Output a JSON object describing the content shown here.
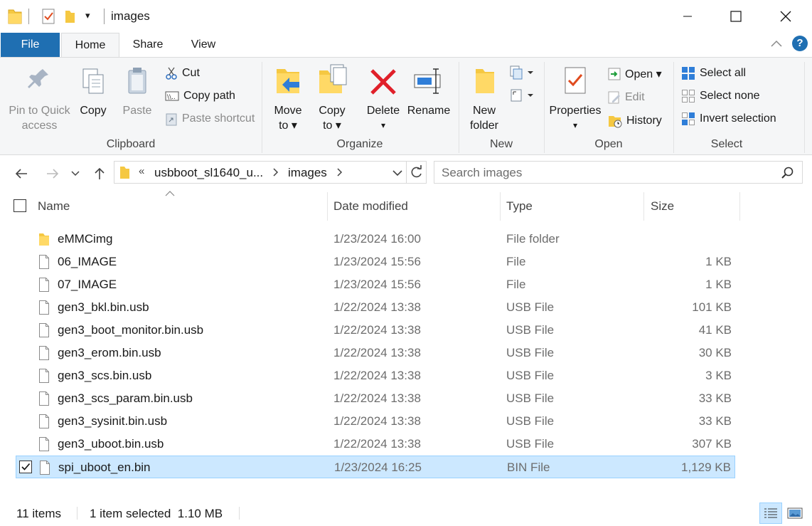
{
  "window": {
    "title": "images",
    "qa_dropdown": "▾",
    "minimize": "—",
    "maximize": "☐",
    "close": "✕"
  },
  "ribbon_tabs": {
    "file": "File",
    "home": "Home",
    "share": "Share",
    "view": "View"
  },
  "clipboard": {
    "pin": "Pin to Quick\naccess",
    "pin_l1": "Pin to Quick",
    "pin_l2": "access",
    "copy": "Copy",
    "paste": "Paste",
    "cut": "Cut",
    "copy_path": "Copy path",
    "paste_shortcut": "Paste shortcut",
    "label": "Clipboard"
  },
  "organize": {
    "move_l1": "Move",
    "move_l2": "to ▾",
    "copy_l1": "Copy",
    "copy_l2": "to ▾",
    "delete": "Delete",
    "delete_arrow": "▾",
    "rename": "Rename",
    "label": "Organize"
  },
  "new": {
    "folder_l1": "New",
    "folder_l2": "folder",
    "label": "New"
  },
  "open": {
    "properties": "Properties",
    "properties_arrow": "▾",
    "open": "Open ▾",
    "edit": "Edit",
    "history": "History",
    "label": "Open"
  },
  "select": {
    "select_all": "Select all",
    "select_none": "Select none",
    "invert": "Invert selection",
    "label": "Select"
  },
  "address": {
    "overflow": "«",
    "segment1": "usbboot_sl1640_u...",
    "segment2": "images",
    "search_placeholder": "Search images"
  },
  "columns": {
    "name": "Name",
    "date": "Date modified",
    "type": "Type",
    "size": "Size"
  },
  "files": [
    {
      "name": "eMMCimg",
      "date": "1/23/2024 16:00",
      "type": "File folder",
      "size": "",
      "kind": "folder"
    },
    {
      "name": "06_IMAGE",
      "date": "1/23/2024 15:56",
      "type": "File",
      "size": "1 KB",
      "kind": "file"
    },
    {
      "name": "07_IMAGE",
      "date": "1/23/2024 15:56",
      "type": "File",
      "size": "1 KB",
      "kind": "file"
    },
    {
      "name": "gen3_bkl.bin.usb",
      "date": "1/22/2024 13:38",
      "type": "USB File",
      "size": "101 KB",
      "kind": "file"
    },
    {
      "name": "gen3_boot_monitor.bin.usb",
      "date": "1/22/2024 13:38",
      "type": "USB File",
      "size": "41 KB",
      "kind": "file"
    },
    {
      "name": "gen3_erom.bin.usb",
      "date": "1/22/2024 13:38",
      "type": "USB File",
      "size": "30 KB",
      "kind": "file"
    },
    {
      "name": "gen3_scs.bin.usb",
      "date": "1/22/2024 13:38",
      "type": "USB File",
      "size": "3 KB",
      "kind": "file"
    },
    {
      "name": "gen3_scs_param.bin.usb",
      "date": "1/22/2024 13:38",
      "type": "USB File",
      "size": "33 KB",
      "kind": "file"
    },
    {
      "name": "gen3_sysinit.bin.usb",
      "date": "1/22/2024 13:38",
      "type": "USB File",
      "size": "33 KB",
      "kind": "file"
    },
    {
      "name": "gen3_uboot.bin.usb",
      "date": "1/22/2024 13:38",
      "type": "USB File",
      "size": "307 KB",
      "kind": "file"
    },
    {
      "name": "spi_uboot_en.bin",
      "date": "1/23/2024 16:25",
      "type": "BIN File",
      "size": "1,129 KB",
      "kind": "file",
      "selected": true
    }
  ],
  "status": {
    "count": "11 items",
    "selection": "1 item selected  1.10 MB"
  },
  "colors": {
    "file_tab": "#1f6fb2",
    "selection_bg": "#cce8ff",
    "selection_border": "#99d1ff",
    "ribbon_bg": "#f5f6f7"
  }
}
